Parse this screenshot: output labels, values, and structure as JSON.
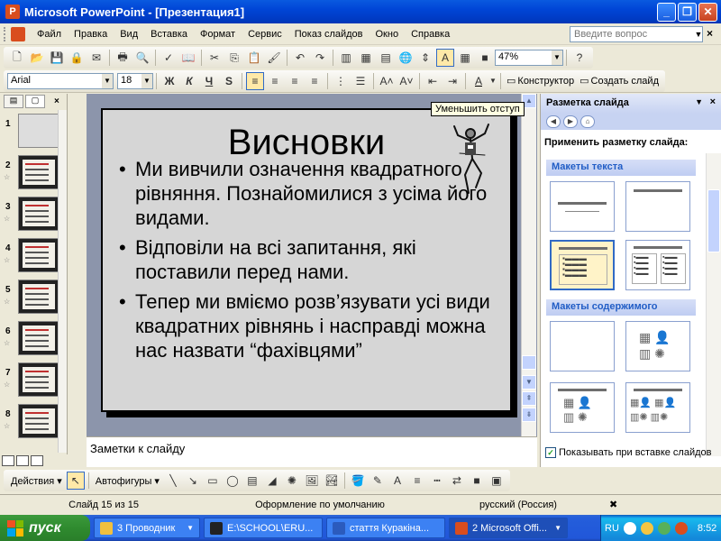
{
  "window": {
    "title": "Microsoft PowerPoint - [Презентация1]",
    "buttons": [
      "_",
      "❐",
      "✕"
    ]
  },
  "menu": {
    "items": [
      "Файл",
      "Правка",
      "Вид",
      "Вставка",
      "Формат",
      "Сервис",
      "Показ слайдов",
      "Окно",
      "Справка"
    ],
    "help_placeholder": "Введите вопрос"
  },
  "toolbar_standard": {
    "zoom": "47%"
  },
  "toolbar_format": {
    "font": "Arial",
    "size": "18",
    "bold": "Ж",
    "italic": "К",
    "underline": "Ч",
    "shadow": "S",
    "designer_label": "Конструктор",
    "new_slide_label": "Создать слайд"
  },
  "tooltip": "Уменьшить отступ",
  "outline_tabs": [
    "▤",
    "▢"
  ],
  "thumbnails": [
    {
      "num": "1",
      "star": false,
      "blank": true
    },
    {
      "num": "2",
      "star": true,
      "blank": false
    },
    {
      "num": "3",
      "star": true,
      "blank": false
    },
    {
      "num": "4",
      "star": true,
      "blank": false
    },
    {
      "num": "5",
      "star": true,
      "blank": false
    },
    {
      "num": "6",
      "star": true,
      "blank": false
    },
    {
      "num": "7",
      "star": true,
      "blank": false
    },
    {
      "num": "8",
      "star": true,
      "blank": false
    }
  ],
  "slide": {
    "title": "Висновки",
    "bullets": [
      "Ми вивчили означення квадратного рівняння. Познайомилися з усіма його видами.",
      "Відповіли на всі запитання, які поставили перед нами.",
      "Тепер ми вміємо розв’язувати усі види квадратних рівнянь і насправді можна нас назвати “фахівцями”"
    ]
  },
  "notes_placeholder": "Заметки к слайду",
  "taskpane": {
    "title": "Разметка слайда",
    "apply_label": "Применить разметку слайда:",
    "text_layouts_label": "Макеты текста",
    "content_layouts_label": "Макеты содержимого",
    "show_on_insert_label": "Показывать при вставке слайдов"
  },
  "drawing_toolbar": {
    "actions_label": "Действия",
    "autoshapes_label": "Автофигуры"
  },
  "statusbar": {
    "slide_info": "Слайд 15 из 15",
    "design": "Оформление по умолчанию",
    "language": "русский (Россия)"
  },
  "taskbar": {
    "start_label": "пуск",
    "tasks": [
      {
        "label": "3 Проводник",
        "color": "#f0c040"
      },
      {
        "label": "E:\\SCHOOL\\ERU...",
        "color": "#222222"
      },
      {
        "label": "стаття Куракіна...",
        "color": "#2b5bbd"
      },
      {
        "label": "2 Microsoft Offi...",
        "color": "#d94d1e"
      }
    ],
    "lang": "RU",
    "time": "8:52"
  }
}
